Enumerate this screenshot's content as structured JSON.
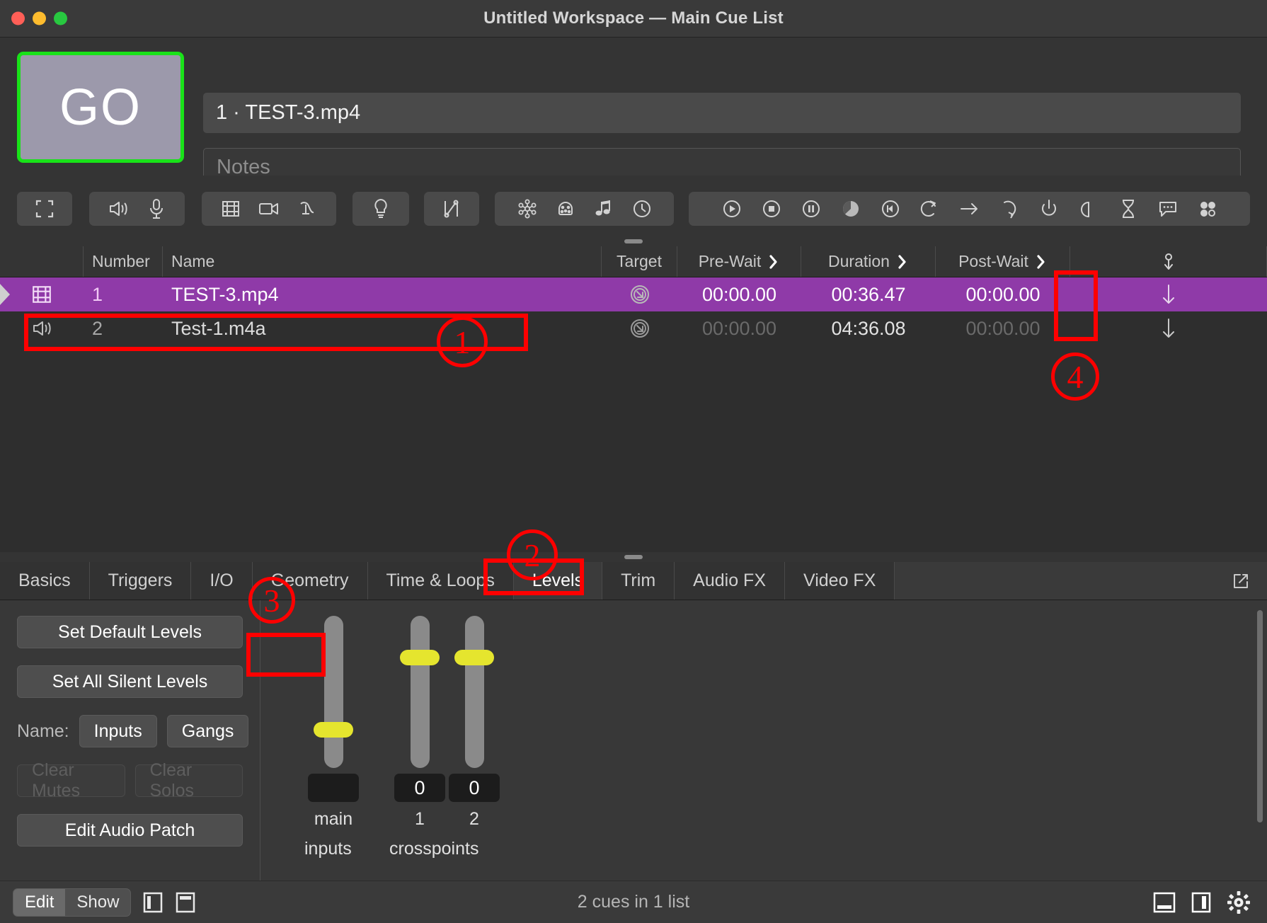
{
  "window": {
    "title": "Untitled Workspace — Main Cue List"
  },
  "header": {
    "go_label": "GO",
    "cue_name_value": "1 · TEST-3.mp4",
    "notes_placeholder": "Notes"
  },
  "toolbar": {
    "groups": [
      {
        "name": "group-fade",
        "icons": [
          "fullscreen-icon"
        ]
      },
      {
        "name": "group-audio",
        "icons": [
          "speaker-icon",
          "microphone-icon"
        ]
      },
      {
        "name": "group-video",
        "icons": [
          "film-icon",
          "camera-icon",
          "text-icon"
        ]
      },
      {
        "name": "group-light",
        "icons": [
          "lightbulb-icon"
        ]
      },
      {
        "name": "group-fade-curve",
        "icons": [
          "fade-icon"
        ]
      },
      {
        "name": "group-network",
        "icons": [
          "network-icon",
          "midi-icon",
          "music-icon",
          "timecode-icon"
        ]
      },
      {
        "name": "group-control",
        "icons": [
          "start-icon",
          "stop-icon",
          "pause-icon",
          "load-icon",
          "reset-icon",
          "goto-icon",
          "target-icon",
          "arrow-icon",
          "devamp-icon",
          "script-icon",
          "wait-icon",
          "hourglass-icon",
          "memo-icon",
          "group-icon"
        ]
      }
    ]
  },
  "cue_list": {
    "columns": [
      "",
      "Number",
      "Name",
      "Target",
      "Pre-Wait",
      "Duration",
      "Post-Wait",
      "Continue"
    ],
    "headers": {
      "number": "Number",
      "name": "Name",
      "target": "Target",
      "pre_wait": "Pre-Wait",
      "duration": "Duration",
      "post_wait": "Post-Wait"
    },
    "rows": [
      {
        "icon": "film-icon",
        "number": "1",
        "name": "TEST-3.mp4",
        "target": "target-disc-icon",
        "pre_wait": "00:00.00",
        "duration": "00:36.47",
        "post_wait": "00:00.00",
        "continue": "arrow-down-icon",
        "selected": true
      },
      {
        "icon": "speaker-icon",
        "number": "2",
        "name": "Test-1.m4a",
        "target": "target-disc-icon",
        "pre_wait": "00:00.00",
        "duration": "04:36.08",
        "post_wait": "00:00.00",
        "continue": "arrow-down-icon",
        "selected": false
      }
    ]
  },
  "inspector": {
    "tabs": [
      {
        "label": "Basics",
        "active": false
      },
      {
        "label": "Triggers",
        "active": false
      },
      {
        "label": "I/O",
        "active": false
      },
      {
        "label": "Geometry",
        "active": false
      },
      {
        "label": "Time & Loops",
        "active": false
      },
      {
        "label": "Levels",
        "active": true
      },
      {
        "label": "Trim",
        "active": false
      },
      {
        "label": "Audio FX",
        "active": false
      },
      {
        "label": "Video FX",
        "active": false
      }
    ],
    "popout_icon": "popout-icon",
    "levels": {
      "set_default_levels": "Set Default Levels",
      "set_all_silent_levels": "Set All Silent Levels",
      "name_label": "Name:",
      "inputs_button": "Inputs",
      "gangs_button": "Gangs",
      "clear_mutes": "Clear Mutes",
      "clear_solos": "Clear Solos",
      "edit_audio_patch": "Edit Audio Patch",
      "faders": [
        {
          "id": "main",
          "label": "main",
          "value": "",
          "group": "inputs",
          "thumb_pct": 72
        },
        {
          "id": "cross1",
          "label": "1",
          "value": "0",
          "group": "crosspoints",
          "thumb_pct": 25
        },
        {
          "id": "cross2",
          "label": "2",
          "value": "0",
          "group": "crosspoints",
          "thumb_pct": 25
        }
      ],
      "group_labels": {
        "inputs": "inputs",
        "crosspoints": "crosspoints"
      }
    }
  },
  "status_bar": {
    "mode_edit": "Edit",
    "mode_show": "Show",
    "layout_icons": [
      "sidebar-left-icon",
      "sidebar-bottom-icon"
    ],
    "cue_count": "2 cues in 1 list",
    "right_icons": [
      "panel-bottom-icon",
      "panel-right-icon",
      "gear-icon"
    ]
  },
  "annotations": [
    {
      "id": "1",
      "type": "box-with-circle",
      "label": "1"
    },
    {
      "id": "2",
      "type": "box-with-circle",
      "label": "2"
    },
    {
      "id": "3",
      "type": "box-with-circle",
      "label": "3"
    },
    {
      "id": "4",
      "type": "box-with-circle",
      "label": "4"
    }
  ],
  "colors": {
    "accent_green": "#19e219",
    "selection_purple": "#8f3aa8",
    "fader_yellow": "#e5e52e",
    "annotation_red": "#ff0000"
  }
}
